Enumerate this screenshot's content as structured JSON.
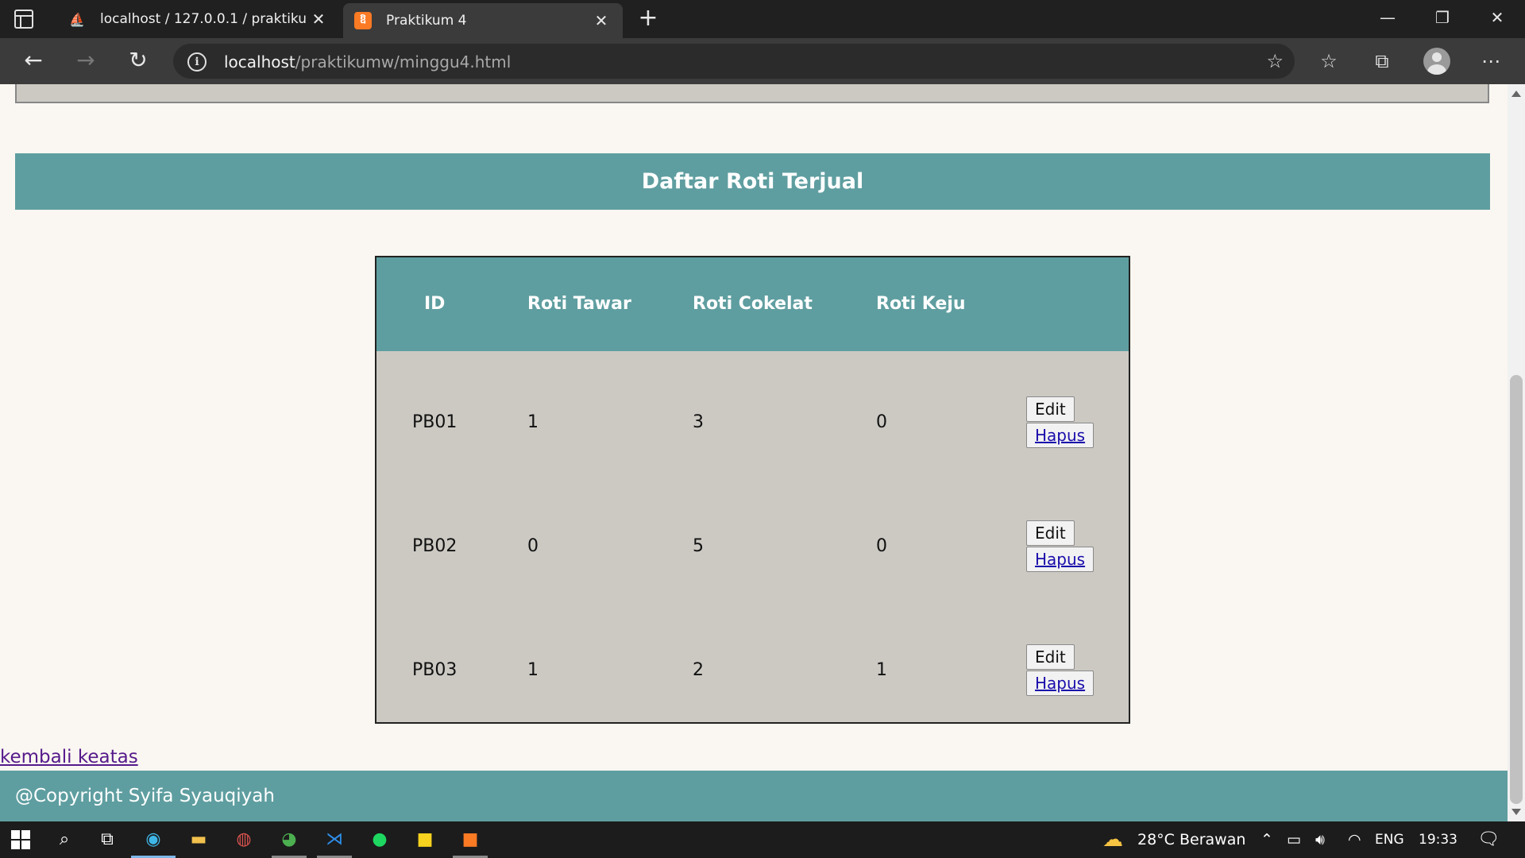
{
  "browser": {
    "tabs": [
      {
        "title": "localhost / 127.0.0.1 / praktikum",
        "favicon": "phpmyadmin-icon"
      },
      {
        "title": "Praktikum 4",
        "favicon": "xampp-icon",
        "active": true
      }
    ],
    "address": {
      "host": "localhost",
      "path": "/praktikumw/minggu4.html"
    }
  },
  "page": {
    "section_title": "Daftar Roti Terjual",
    "table": {
      "headers": [
        "ID",
        "Roti Tawar",
        "Roti Cokelat",
        "Roti Keju",
        ""
      ],
      "rows": [
        {
          "id": "PB01",
          "tawar": "1",
          "cokelat": "3",
          "keju": "0"
        },
        {
          "id": "PB02",
          "tawar": "0",
          "cokelat": "5",
          "keju": "0"
        },
        {
          "id": "PB03",
          "tawar": "1",
          "cokelat": "2",
          "keju": "1"
        }
      ],
      "edit_label": "Edit",
      "delete_label": "Hapus"
    },
    "back_link": "kembali keatas",
    "footer": "@Copyright Syifa Syauqiyah",
    "colors": {
      "accent": "#5f9ea0",
      "table_body": "#ccc9c3",
      "page_bg": "#faf6f1"
    }
  },
  "taskbar": {
    "weather": "28°C  Berawan",
    "language": "ENG",
    "time": "19:33"
  }
}
